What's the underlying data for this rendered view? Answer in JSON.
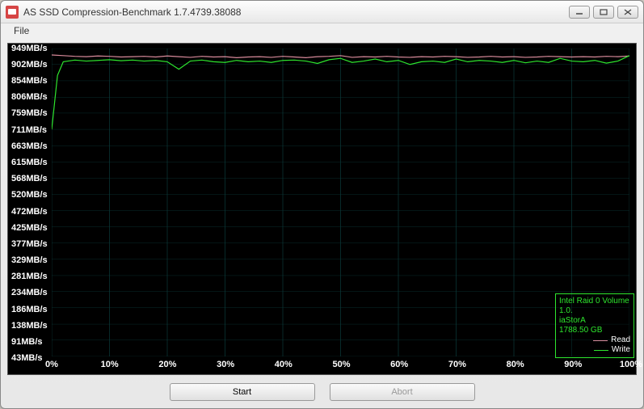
{
  "window": {
    "title": "AS SSD Compression-Benchmark 1.7.4739.38088"
  },
  "menu": {
    "file": "File"
  },
  "legend": {
    "device": "Intel Raid 0 Volume 1.0.",
    "driver": "iaStorA",
    "capacity": "1788.50 GB",
    "read": "Read",
    "write": "Write"
  },
  "buttons": {
    "start": "Start",
    "abort": "Abort"
  },
  "colors": {
    "read": "#d88a9a",
    "write": "#2ee62e",
    "grid": "#0a3a3a"
  },
  "chart_data": {
    "type": "line",
    "title": "",
    "xlabel": "",
    "ylabel": "",
    "xlim": [
      0,
      100
    ],
    "ylim": [
      43,
      949
    ],
    "y_ticks": [
      949,
      902,
      854,
      806,
      759,
      711,
      663,
      615,
      568,
      520,
      472,
      425,
      377,
      329,
      281,
      234,
      186,
      138,
      91,
      43
    ],
    "y_unit": "MB/s",
    "x_ticks": [
      0,
      10,
      20,
      30,
      40,
      50,
      60,
      70,
      80,
      90,
      100
    ],
    "x_unit": "%",
    "series": [
      {
        "name": "Read",
        "color": "#d88a9a",
        "x": [
          0,
          2,
          4,
          6,
          8,
          10,
          12,
          14,
          16,
          18,
          20,
          22,
          24,
          26,
          28,
          30,
          32,
          34,
          36,
          38,
          40,
          42,
          44,
          46,
          48,
          50,
          52,
          54,
          56,
          58,
          60,
          62,
          64,
          66,
          68,
          70,
          72,
          74,
          76,
          78,
          80,
          82,
          84,
          86,
          88,
          90,
          92,
          94,
          96,
          98,
          100
        ],
        "values": [
          930,
          928,
          926,
          925,
          927,
          926,
          924,
          925,
          926,
          924,
          927,
          925,
          923,
          926,
          924,
          925,
          922,
          924,
          925,
          923,
          926,
          924,
          922,
          925,
          926,
          928,
          923,
          925,
          924,
          926,
          924,
          923,
          925,
          924,
          926,
          925,
          923,
          924,
          926,
          924,
          925,
          923,
          924,
          926,
          925,
          924,
          925,
          924,
          926,
          925,
          927
        ]
      },
      {
        "name": "Write",
        "color": "#2ee62e",
        "x": [
          0,
          1,
          2,
          4,
          6,
          8,
          10,
          12,
          14,
          16,
          18,
          20,
          22,
          24,
          26,
          28,
          30,
          32,
          34,
          36,
          38,
          40,
          42,
          44,
          46,
          48,
          50,
          52,
          54,
          56,
          58,
          60,
          62,
          64,
          66,
          68,
          70,
          72,
          74,
          76,
          78,
          80,
          82,
          84,
          86,
          88,
          90,
          92,
          94,
          96,
          98,
          100
        ],
        "values": [
          711,
          870,
          910,
          915,
          912,
          914,
          916,
          913,
          915,
          912,
          914,
          910,
          888,
          912,
          915,
          910,
          908,
          914,
          910,
          912,
          908,
          914,
          915,
          912,
          905,
          916,
          920,
          908,
          912,
          918,
          910,
          914,
          902,
          910,
          912,
          908,
          918,
          910,
          914,
          912,
          908,
          914,
          907,
          912,
          908,
          920,
          912,
          910,
          914,
          906,
          912,
          928
        ]
      }
    ]
  }
}
